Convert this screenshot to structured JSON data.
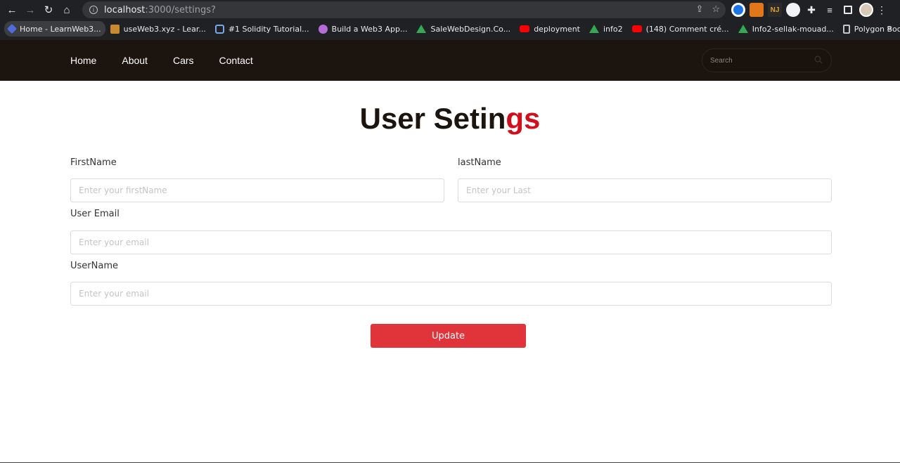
{
  "browser": {
    "url_host": "localhost",
    "url_path": ":3000/settings?",
    "bookmarks": [
      {
        "label": "Home - LearnWeb3...",
        "icon": "diamond-icon"
      },
      {
        "label": "useWeb3.xyz - Lear...",
        "icon": "tools-icon"
      },
      {
        "label": "#1 Solidity Tutorial...",
        "icon": "link-icon"
      },
      {
        "label": "Build a Web3 App...",
        "icon": "unicorn-icon"
      },
      {
        "label": "SaleWebDesign.Co...",
        "icon": "drive-icon"
      },
      {
        "label": "deployment",
        "icon": "youtube-icon"
      },
      {
        "label": "info2",
        "icon": "drive-icon"
      },
      {
        "label": "(148) Comment cré...",
        "icon": "youtube-icon"
      },
      {
        "label": "Info2-sellak-mouad...",
        "icon": "drive-icon"
      },
      {
        "label": "Polygon Bootcamp...",
        "icon": "polygon-icon"
      }
    ],
    "bookmarks_more": "»"
  },
  "navbar": {
    "links": [
      "Home",
      "About",
      "Cars",
      "Contact"
    ],
    "search_placeholder": "Search"
  },
  "page": {
    "title_main": "User Setin",
    "title_accent": "gs",
    "accent_color": "#d10e1b",
    "form": {
      "first_name_label": "FirstName",
      "first_name_placeholder": "Enter your firstName",
      "last_name_label": "lastName",
      "last_name_placeholder": "Enter your Last",
      "email_label": "User Email",
      "email_placeholder": "Enter your email",
      "username_label": "UserName",
      "username_placeholder": "Enter your email",
      "submit_label": "Update"
    }
  }
}
